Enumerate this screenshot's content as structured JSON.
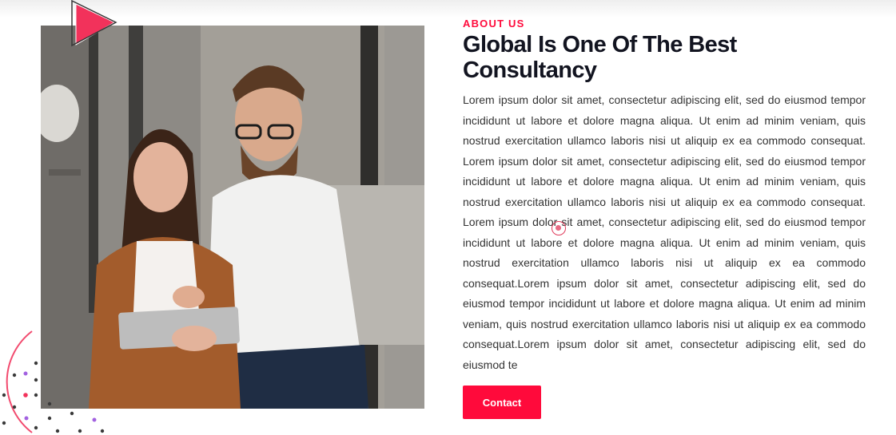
{
  "about": {
    "eyebrow": "ABOUT US",
    "title": "Global Is One Of The Best Consultancy",
    "body": "Lorem ipsum dolor sit amet, consectetur adipiscing elit, sed do eiusmod tempor incididunt ut labore et dolore magna aliqua. Ut enim ad minim veniam, quis nostrud exercitation ullamco laboris nisi ut aliquip ex ea commodo consequat. Lorem ipsum dolor sit amet, consectetur adipiscing elit, sed do eiusmod tempor incididunt ut labore et dolore magna aliqua. Ut enim ad minim veniam, quis nostrud exercitation ullamco laboris nisi ut aliquip ex ea commodo consequat. Lorem ipsum dolor sit amet, consectetur adipiscing elit, sed do eiusmod tempor incididunt ut labore et dolore magna aliqua. Ut enim ad minim veniam, quis nostrud exercitation ullamco laboris nisi ut aliquip ex ea commodo consequat.Lorem ipsum dolor sit amet, consectetur adipiscing elit, sed do eiusmod tempor incididunt ut labore et dolore magna aliqua. Ut enim ad minim veniam, quis nostrud exercitation ullamco laboris nisi ut aliquip ex ea commodo consequat.Lorem ipsum dolor sit amet, consectetur adipiscing elit, sed do eiusmod te",
    "button_label": "Contact"
  },
  "theme": {
    "accent": "#ff0a3b",
    "heading": "#121420",
    "text": "#333333"
  },
  "icons": {
    "decoration_top": "play-triangle-icon",
    "cursor": "cursor-ring-icon"
  }
}
